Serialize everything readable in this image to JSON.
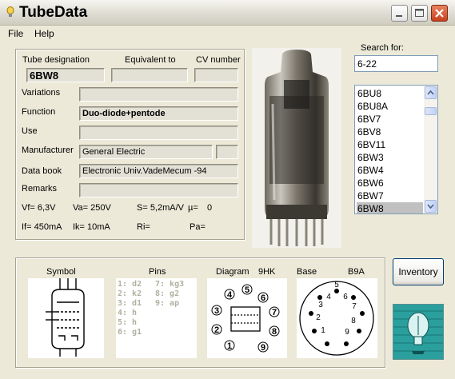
{
  "window": {
    "title": "TubeData"
  },
  "menu": {
    "file": "File",
    "help": "Help"
  },
  "tube": {
    "designation_label": "Tube designation",
    "equivalent_label": "Equivalent to",
    "cv_label": "CV number",
    "designation": "6BW8",
    "variations_label": "Variations",
    "function_label": "Function",
    "function": "Duo-diode+pentode",
    "use_label": "Use",
    "manufacturer_label": "Manufacturer",
    "manufacturer": "General Electric",
    "databook_label": "Data book",
    "databook": "Electronic Univ.VadeMecum -94",
    "remarks_label": "Remarks"
  },
  "params": {
    "vf": "Vf= 6,3V",
    "va": "Va= 250V",
    "s": "S= 5,2mA/V",
    "mu": "µ=",
    "mu_val": "0",
    "if": "If= 450mA",
    "ik": "Ik=  10mA",
    "ri": "Ri=",
    "pa": "Pa="
  },
  "search": {
    "label": "Search for:",
    "value": "6-22"
  },
  "list_items": [
    "6BU8",
    "6BU8A",
    "6BV7",
    "6BV8",
    "6BV11",
    "6BW3",
    "6BW4",
    "6BW6",
    "6BW7",
    "6BW8"
  ],
  "selected_item": "6BW8",
  "bottom": {
    "symbol_label": "Symbol",
    "pins_label": "Pins",
    "diagram_label": "Diagram",
    "diagram_code": "9HK",
    "base_label": "Base",
    "base_code": "B9A",
    "pins_col1": [
      "1: d2",
      "2: k2",
      "3: d1",
      "4: h",
      "5: h",
      "6: g1"
    ],
    "pins_col2": [
      "7: kg3",
      "8: g2",
      "9: ap"
    ],
    "diagram_pin_numbers": [
      "1",
      "2",
      "3",
      "4",
      "5",
      "6",
      "7",
      "8",
      "9"
    ],
    "base_pin_numbers": [
      "1",
      "2",
      "3",
      "4",
      "5",
      "6",
      "7",
      "8",
      "9"
    ]
  },
  "inventory_button": "Inventory"
}
